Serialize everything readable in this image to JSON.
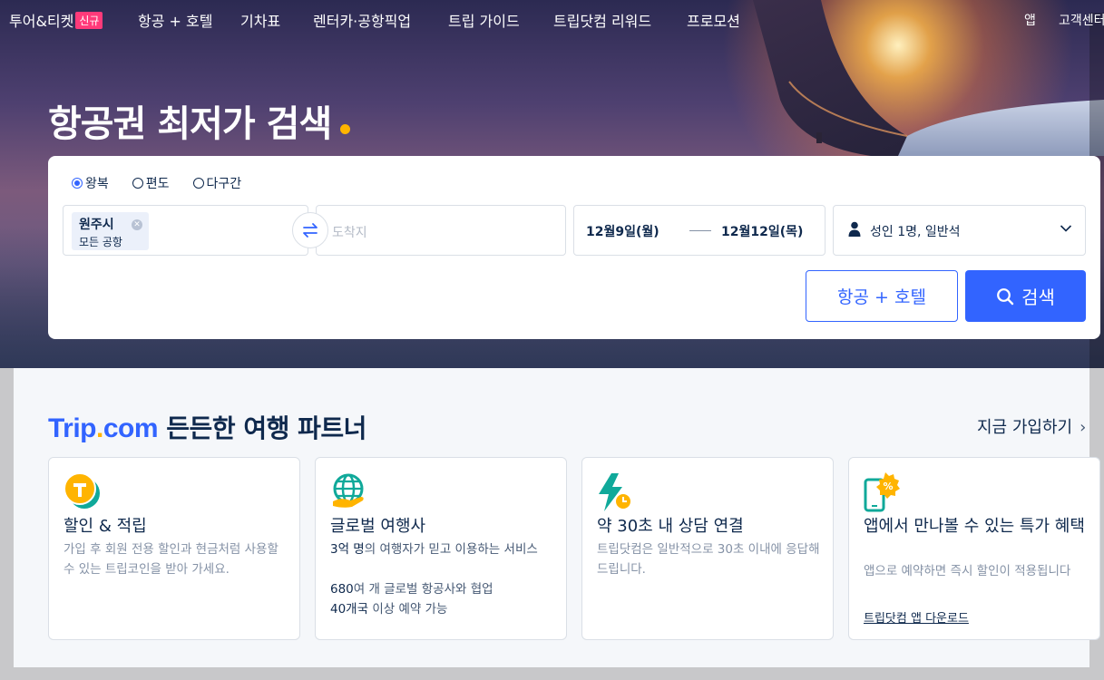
{
  "nav": {
    "items": [
      "투어&티켓",
      "항공 + 호텔",
      "기차표",
      "렌터카·공항픽업",
      "트립 가이드",
      "트립닷컴 리워드",
      "프로모션"
    ],
    "badge": "신규",
    "app": "앱",
    "support": "고객센터"
  },
  "hero": {
    "title": "항공권 최저가 검색"
  },
  "search": {
    "trip_types": [
      "왕복",
      "편도",
      "다구간"
    ],
    "selected_trip_type": "왕복",
    "origin": {
      "city": "원주시",
      "airport": "모든 공항"
    },
    "destination_placeholder": "도착지",
    "depart_date": "12월9일(월)",
    "return_date": "12월12일(목)",
    "passengers": "성인 1명, 일반석",
    "flight_hotel_label": "항공 + 호텔",
    "search_label": "검색"
  },
  "partner": {
    "logo_main": "Trip",
    "logo_dot": ".",
    "logo_tld": "com",
    "title": "든든한 여행 파트너",
    "join": "지금 가입하기",
    "cards": [
      {
        "icon": "trip-coin-icon",
        "title": "할인 & 적립",
        "lines": [
          "가입 후 회원 전용 할인과 현금처럼 사용할 수 있는 트립코인을 받아 가세요."
        ]
      },
      {
        "icon": "globe-hand-icon",
        "title": "글로벌 여행사",
        "lines": [
          {
            "strong": "3억 명",
            "text": "의 여행자가 믿고 이용하는 서비스"
          },
          {
            "strong": "680",
            "text": "여 개 글로벌 항공사와 협업"
          },
          {
            "strong": "40개국",
            "text": " 이상 예약 가능"
          }
        ]
      },
      {
        "icon": "lightning-clock-icon",
        "title": "약 30초 내 상담 연결",
        "lines": [
          "트립닷컴은 일반적으로 30초 이내에 응답해 드립니다."
        ]
      },
      {
        "icon": "phone-discount-icon",
        "title": "앱에서 만나볼 수 있는 특가 혜택",
        "lines": [
          "앱으로 예약하면 즉시 할인이 적용됩니다"
        ],
        "link": "트립닷컴 앱 다운로드"
      }
    ]
  },
  "colors": {
    "primary": "#3264ff",
    "text": "#0f294d",
    "accent_dot": "#ffb400",
    "badge": "#ff3a7a"
  }
}
